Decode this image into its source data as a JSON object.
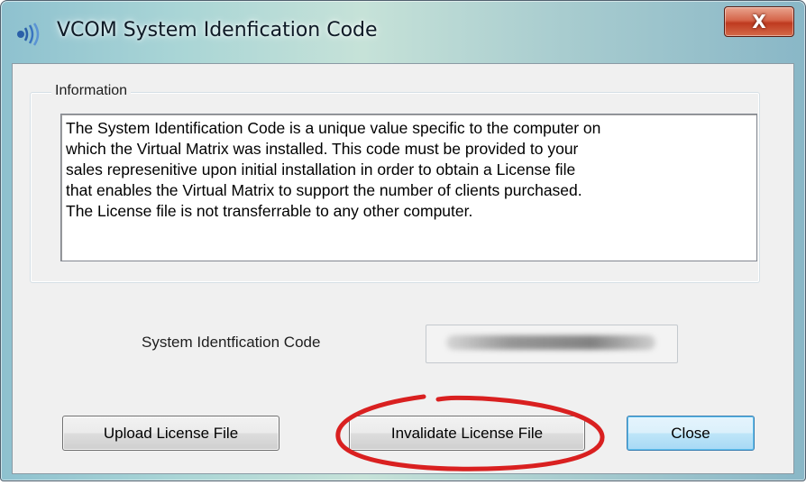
{
  "window": {
    "title": "VCOM System Idenfication Code",
    "close_label": "X"
  },
  "group": {
    "label": "Information",
    "text": "The System Identification Code is a unique value specific to the computer on\nwhich the Virtual Matrix was installed.  This code must be provided to your\nsales represenitive upon initial installation in order to obtain a License file\nthat enables the Virtual Matrix to support the number of clients purchased.\nThe License file is not transferrable to any other computer."
  },
  "code": {
    "label": "System Identfication Code"
  },
  "buttons": {
    "upload": "Upload License File",
    "invalidate": "Invalidate License File",
    "close": "Close"
  },
  "colors": {
    "highlight_ellipse": "#d92020",
    "default_button_border": "#3c7fb1"
  },
  "icons": {
    "app": "sound-waves-icon",
    "close": "close-icon"
  }
}
